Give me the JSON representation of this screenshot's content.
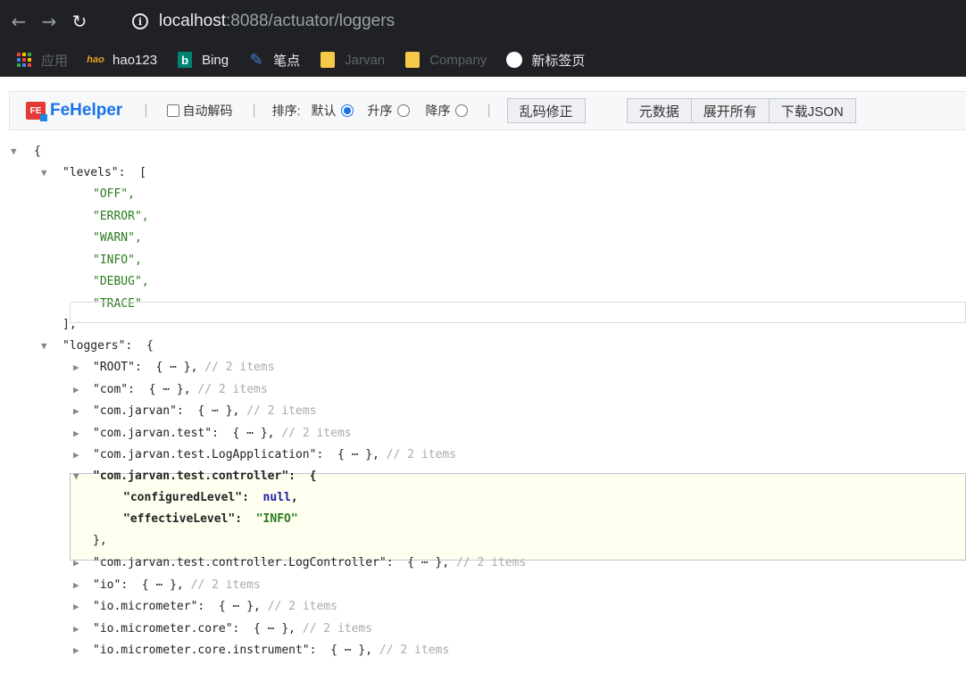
{
  "browser": {
    "url_host": "localhost",
    "url_rest": ":8088/actuator/loggers",
    "bookmarks": [
      {
        "label": "应用",
        "icon": "apps-grid-icon",
        "dim": true
      },
      {
        "label": "hao123",
        "icon": "hao123-icon",
        "dim": false
      },
      {
        "label": "Bing",
        "icon": "bing-icon",
        "dim": false
      },
      {
        "label": "笔点",
        "icon": "pen-icon",
        "dim": false
      },
      {
        "label": "Jarvan",
        "icon": "folder-icon",
        "dim": true
      },
      {
        "label": "Company",
        "icon": "folder-icon",
        "dim": true
      },
      {
        "label": "新标签页",
        "icon": "globe-icon",
        "dim": false
      }
    ]
  },
  "toolbar": {
    "logo_badge": "FE",
    "brand": "FeHelper",
    "sep": "|",
    "auto_decode": "自动解码",
    "sort_label": "排序:",
    "sort_default": "默认",
    "sort_asc": "升序",
    "sort_desc": "降序",
    "fix_garbled": "乱码修正",
    "metadata": "元数据",
    "expand_all": "展开所有",
    "download_json": "下载JSON"
  },
  "json": {
    "open_brace": "{",
    "levels_key": "\"levels\"",
    "levels_open": "[",
    "levels": [
      "\"OFF\",",
      "\"ERROR\",",
      "\"WARN\",",
      "\"INFO\",",
      "\"DEBUG\",",
      "\"TRACE\""
    ],
    "levels_close": "],",
    "loggers_key": "\"loggers\"",
    "loggers_open": "{",
    "collapsed_marker": "{ ⋯ },",
    "items_comment": "// 2 items",
    "loggers_before": [
      "\"ROOT\"",
      "\"com\"",
      "\"com.jarvan\"",
      "\"com.jarvan.test\"",
      "\"com.jarvan.test.LogApplication\""
    ],
    "expanded": {
      "key": "\"com.jarvan.test.controller\"",
      "open": "{",
      "configured_key": "\"configuredLevel\"",
      "configured_val": "null",
      "effective_key": "\"effectiveLevel\"",
      "effective_val": "\"INFO\"",
      "close": "},"
    },
    "loggers_after": [
      "\"com.jarvan.test.controller.LogController\"",
      "\"io\"",
      "\"io.micrometer\"",
      "\"io.micrometer.core\"",
      "\"io.micrometer.core.instrument\""
    ]
  }
}
